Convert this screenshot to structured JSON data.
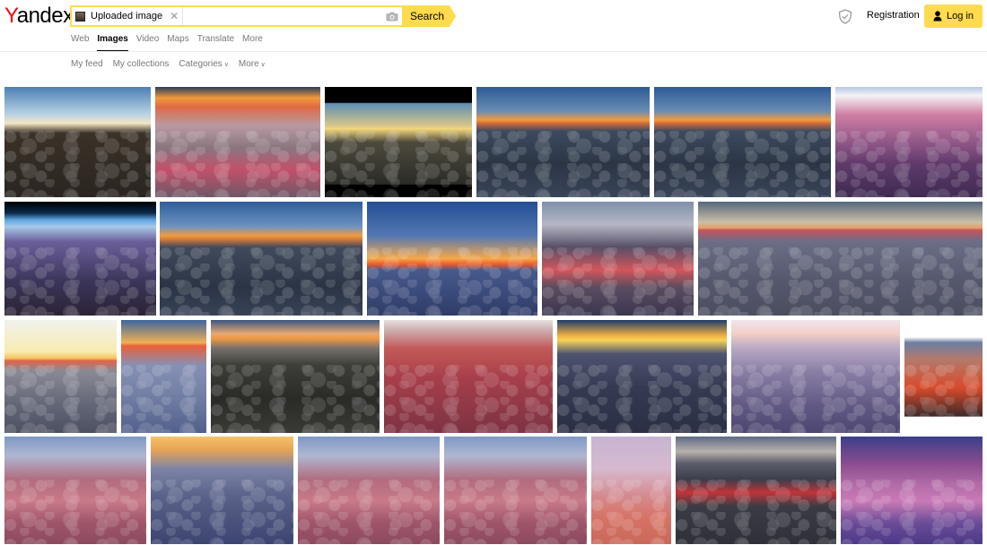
{
  "header": {
    "logo_first": "Y",
    "logo_rest": "andex",
    "uploaded_chip_label": "Uploaded image",
    "search_placeholder": "",
    "search_button": "Search",
    "registration": "Registration",
    "login": "Log in"
  },
  "nav": {
    "tabs": [
      {
        "label": "Web",
        "active": false
      },
      {
        "label": "Images",
        "active": true
      },
      {
        "label": "Video",
        "active": false
      },
      {
        "label": "Maps",
        "active": false
      },
      {
        "label": "Translate",
        "active": false
      },
      {
        "label": "More",
        "active": false
      }
    ]
  },
  "subnav": {
    "my_feed": "My feed",
    "my_collections": "My collections",
    "categories": "Categories",
    "more": "More"
  },
  "colors": {
    "accent": "#ffdb4d",
    "logo_red": "#ff0000",
    "muted_text": "#777777"
  },
  "results": {
    "subject": "sunset-above-clouds",
    "rows": [
      {
        "count": 6
      },
      {
        "count": 5
      },
      {
        "count": 7
      },
      {
        "count": 7
      }
    ]
  }
}
